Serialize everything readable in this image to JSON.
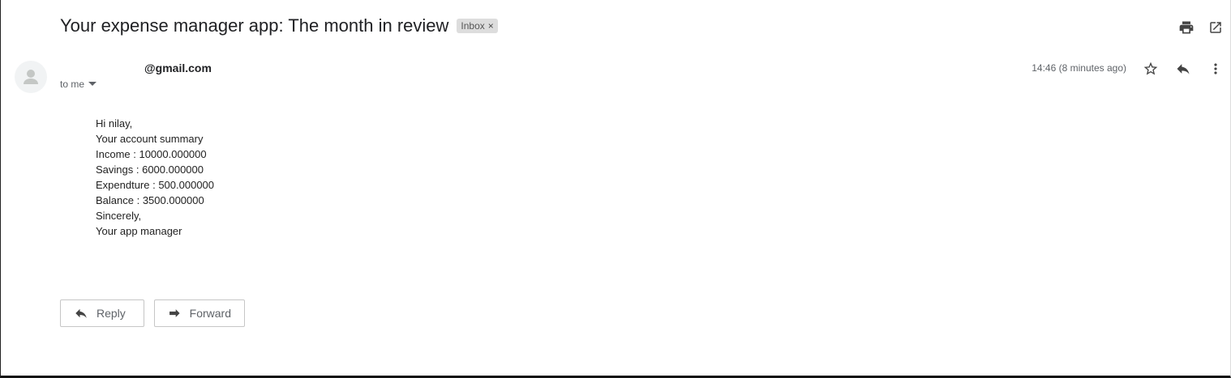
{
  "message": {
    "subject": "Your expense manager app: The month in review",
    "label": "Inbox",
    "sender_email": "@gmail.com",
    "recipient_text": "to me",
    "timestamp": "14:46 (8 minutes ago)"
  },
  "body_lines": [
    "Hi nilay,",
    "Your account summary",
    "Income : 10000.000000",
    "Savings : 6000.000000",
    "Expendture : 500.000000",
    "Balance : 3500.000000",
    "Sincerely,",
    "Your app manager"
  ],
  "actions": {
    "reply_label": "Reply",
    "forward_label": "Forward"
  },
  "icons": {
    "top": [
      "print-icon",
      "open-in-new-window-icon"
    ],
    "message": [
      "star-icon",
      "reply-icon",
      "more-vert-icon"
    ]
  },
  "colors": {
    "text": "#202124",
    "secondary": "#5f6368",
    "chip_bg": "#dddddd"
  }
}
